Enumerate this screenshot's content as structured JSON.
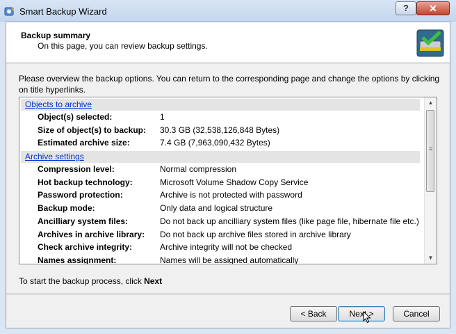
{
  "window": {
    "title": "Smart Backup Wizard",
    "help_label": "?",
    "close_label": "✕"
  },
  "header": {
    "title": "Backup summary",
    "subtitle": "On this page, you can review backup settings."
  },
  "intro_text": "Please overview the backup options. You can return to the corresponding page and change the options by clicking on title hyperlinks.",
  "sections": [
    {
      "title": "Objects to archive",
      "rows": [
        {
          "label": "Object(s) selected:",
          "value": "1"
        },
        {
          "label": "Size of object(s) to backup:",
          "value": "30.3 GB (32,538,126,848 Bytes)"
        },
        {
          "label": "Estimated archive size:",
          "value": "7.4 GB (7,963,090,432 Bytes)"
        }
      ]
    },
    {
      "title": "Archive settings",
      "rows": [
        {
          "label": "Compression level:",
          "value": "Normal compression"
        },
        {
          "label": "Hot backup technology:",
          "value": "Microsoft Volume Shadow Copy Service"
        },
        {
          "label": "Password protection:",
          "value": "Archive is not protected with password"
        },
        {
          "label": "Backup mode:",
          "value": "Only data and logical structure"
        },
        {
          "label": "Ancilliary system files:",
          "value": "Do not back up ancilliary system files (like page file, hibernate file etc.)"
        },
        {
          "label": "Archives in archive library:",
          "value": "Do not back up archive files stored in archive library"
        },
        {
          "label": "Check archive integrity:",
          "value": "Archive integrity will not be checked"
        },
        {
          "label": "Names assignment:",
          "value": "Names will be assigned automatically"
        }
      ]
    }
  ],
  "footer": {
    "note_prefix": "To start the backup process, click ",
    "note_bold": "Next"
  },
  "buttons": {
    "back": "< Back",
    "next": "Next >",
    "cancel": "Cancel"
  },
  "colors": {
    "link": "#0033cc",
    "titlebar": "#c4d6ee",
    "section_bg": "#e4e4e4"
  },
  "icons": {
    "app": "backup-disk-icon",
    "wizard": "backup-drive-checkmark-icon",
    "scroll_up": "chevron-up-icon",
    "scroll_down": "chevron-down-icon"
  }
}
